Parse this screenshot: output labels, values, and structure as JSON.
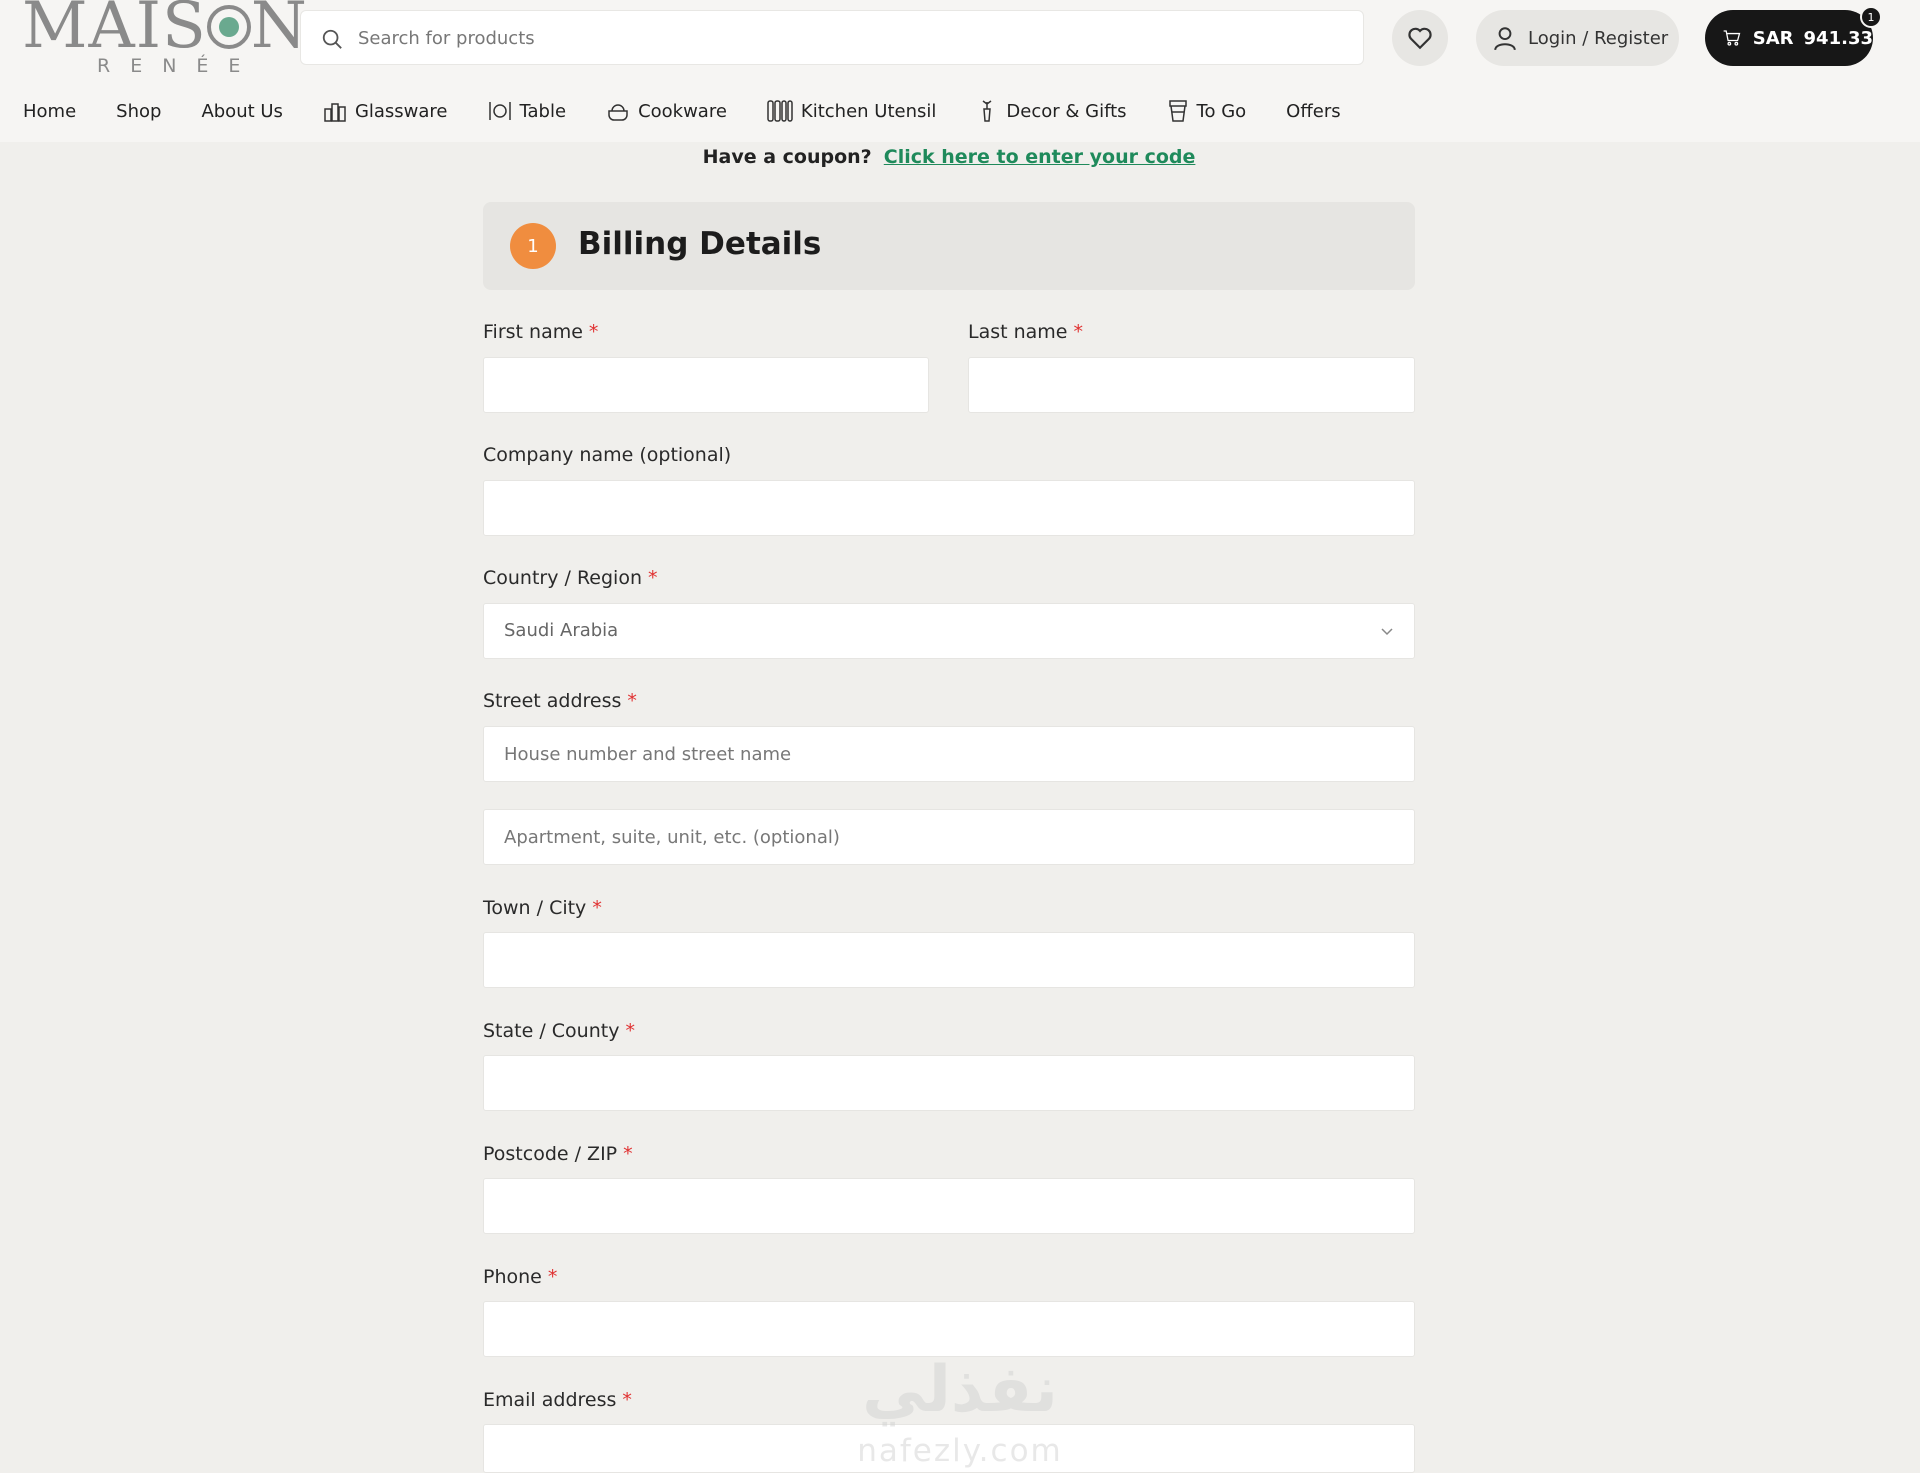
{
  "header": {
    "logo": {
      "main": "MAISON",
      "sub": "RENÉE"
    },
    "search": {
      "placeholder": "Search for products"
    },
    "login_label": "Login / Register",
    "cart": {
      "currency": "SAR",
      "amount": "941.33",
      "count": "1"
    }
  },
  "nav": [
    {
      "label": "Home",
      "icon": ""
    },
    {
      "label": "Shop",
      "icon": ""
    },
    {
      "label": "About Us",
      "icon": ""
    },
    {
      "label": "Glassware",
      "icon": "glassware-icon"
    },
    {
      "label": "Table",
      "icon": "table-icon"
    },
    {
      "label": "Cookware",
      "icon": "cookware-icon"
    },
    {
      "label": "Kitchen Utensil",
      "icon": "utensil-icon"
    },
    {
      "label": "Decor & Gifts",
      "icon": "decor-icon"
    },
    {
      "label": "To Go",
      "icon": "to-go-icon"
    },
    {
      "label": "Offers",
      "icon": ""
    }
  ],
  "coupon": {
    "question": "Have a coupon?",
    "link": "Click here to enter your code"
  },
  "billing": {
    "step": "1",
    "title": "Billing Details",
    "fields": {
      "first_name": {
        "label": "First name",
        "required": "*"
      },
      "last_name": {
        "label": "Last name",
        "required": "*"
      },
      "company": {
        "label": "Company name (optional)"
      },
      "country": {
        "label": "Country / Region",
        "required": "*",
        "value": "Saudi Arabia"
      },
      "street": {
        "label": "Street address",
        "required": "*",
        "placeholder1": "House number and street name",
        "placeholder2": "Apartment, suite, unit, etc. (optional)"
      },
      "city": {
        "label": "Town / City",
        "required": "*"
      },
      "state": {
        "label": "State / County",
        "required": "*"
      },
      "postcode": {
        "label": "Postcode / ZIP",
        "required": "*"
      },
      "phone": {
        "label": "Phone",
        "required": "*"
      },
      "email": {
        "label": "Email address",
        "required": "*"
      }
    }
  },
  "watermark": {
    "arabic": "نفذلي",
    "english": "nafezly.com"
  },
  "colors": {
    "accent": "#1f8a5b",
    "step": "#f08d3f",
    "required": "#e03131",
    "cart_bg": "#171717"
  }
}
